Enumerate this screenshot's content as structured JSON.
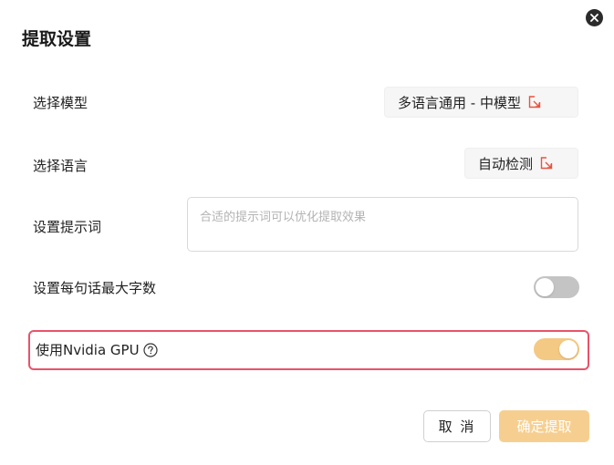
{
  "dialog": {
    "title": "提取设置"
  },
  "model_row": {
    "label": "选择模型",
    "value": "多语言通用 - 中模型"
  },
  "language_row": {
    "label": "选择语言",
    "value": "自动检测"
  },
  "prompt_row": {
    "label": "设置提示词",
    "placeholder": "合适的提示词可以优化提取效果",
    "value": ""
  },
  "max_chars_row": {
    "label": "设置每句话最大字数",
    "toggle_on": false
  },
  "gpu_row": {
    "label": "使用Nvidia GPU",
    "toggle_on": true,
    "highlight_color": "#e8536a"
  },
  "footer": {
    "cancel_label": "取 消",
    "confirm_label": "确定提取"
  },
  "colors": {
    "accent": "#f4c983",
    "confirm_button": "#f6cf90",
    "select_icon": "#e8533f",
    "toggle_off": "#c4c4c4"
  },
  "icons": {
    "close": "close-icon",
    "select": "open-select-icon",
    "help": "help-circle-icon"
  }
}
